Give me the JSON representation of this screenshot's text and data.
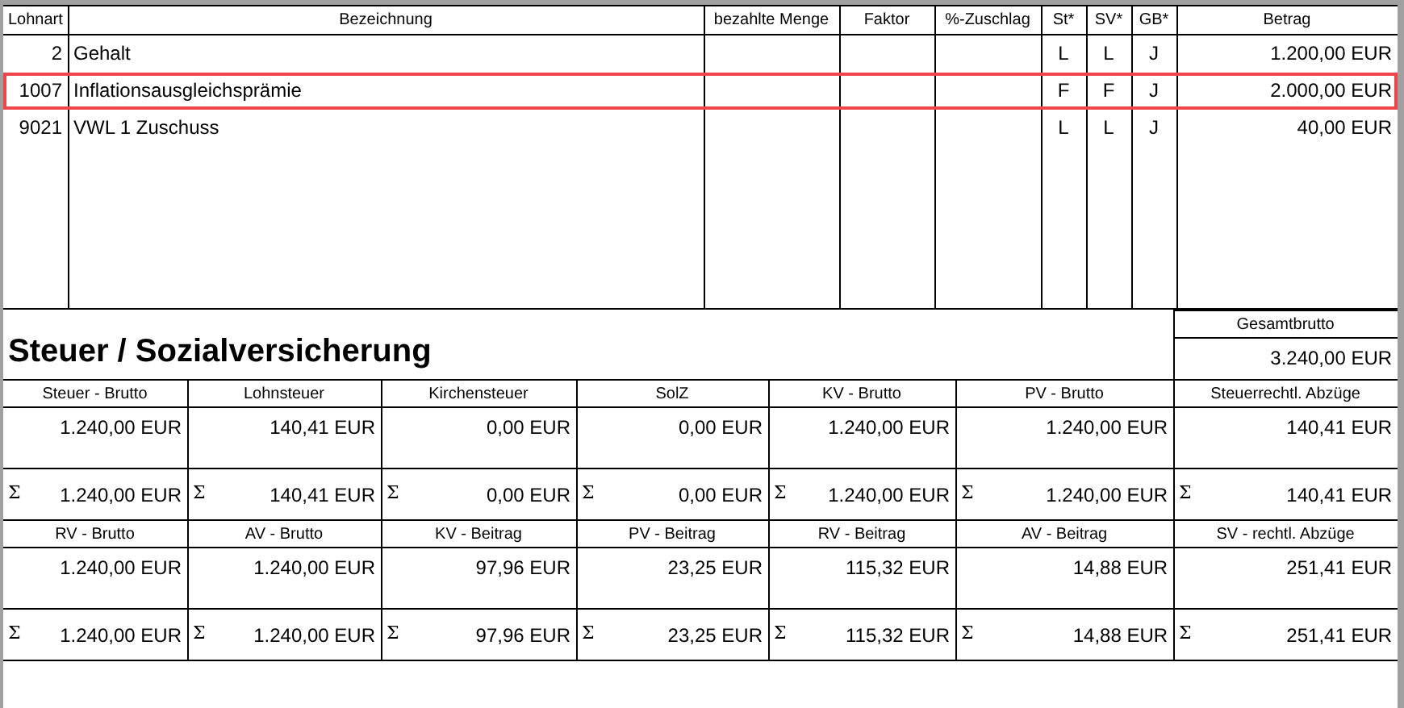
{
  "table": {
    "columns": [
      "Lohnart",
      "Bezeichnung",
      "bezahlte Menge",
      "Faktor",
      "%-Zuschlag",
      "St*",
      "SV*",
      "GB*",
      "Betrag"
    ],
    "rows": [
      {
        "lohnart": "2",
        "bezeichnung": "Gehalt",
        "st": "L",
        "sv": "L",
        "gb": "J",
        "betrag": "1.200,00 EUR",
        "selected": false
      },
      {
        "lohnart": "1007",
        "bezeichnung": "Inflationsausgleichsprämie",
        "st": "F",
        "sv": "F",
        "gb": "J",
        "betrag": "2.000,00 EUR",
        "selected": true
      },
      {
        "lohnart": "9021",
        "bezeichnung": "VWL 1 Zuschuss",
        "st": "L",
        "sv": "L",
        "gb": "J",
        "betrag": "40,00 EUR",
        "selected": false
      }
    ]
  },
  "section": {
    "title": "Steuer / Sozialversicherung",
    "total": {
      "label": "Gesamtbrutto",
      "value": "3.240,00 EUR"
    },
    "blocks": [
      [
        {
          "label": "Steuer - Brutto",
          "value": "1.240,00 EUR",
          "sum_sign": "Σ",
          "sum": "1.240,00 EUR"
        },
        {
          "label": "Lohnsteuer",
          "value": "140,41 EUR",
          "sum_sign": "Σ",
          "sum": "140,41 EUR"
        },
        {
          "label": "Kirchensteuer",
          "value": "0,00 EUR",
          "sum_sign": "Σ",
          "sum": "0,00 EUR"
        },
        {
          "label": "SolZ",
          "value": "0,00 EUR",
          "sum_sign": "Σ",
          "sum": "0,00 EUR"
        },
        {
          "label": "KV - Brutto",
          "value": "1.240,00 EUR",
          "sum_sign": "Σ",
          "sum": "1.240,00 EUR"
        },
        {
          "label": "PV - Brutto",
          "value": "1.240,00 EUR",
          "sum_sign": "Σ",
          "sum": "1.240,00 EUR"
        },
        {
          "label": "Steuerrechtl. Abzüge",
          "value": "140,41 EUR",
          "sum_sign": "Σ",
          "sum": "140,41 EUR"
        }
      ],
      [
        {
          "label": "RV - Brutto",
          "value": "1.240,00 EUR",
          "sum_sign": "Σ",
          "sum": "1.240,00 EUR"
        },
        {
          "label": "AV - Brutto",
          "value": "1.240,00 EUR",
          "sum_sign": "Σ",
          "sum": "1.240,00 EUR"
        },
        {
          "label": "KV - Beitrag",
          "value": "97,96 EUR",
          "sum_sign": "Σ",
          "sum": "97,96 EUR"
        },
        {
          "label": "PV - Beitrag",
          "value": "23,25 EUR",
          "sum_sign": "Σ",
          "sum": "23,25 EUR"
        },
        {
          "label": "RV - Beitrag",
          "value": "115,32 EUR",
          "sum_sign": "Σ",
          "sum": "115,32 EUR"
        },
        {
          "label": "AV - Beitrag",
          "value": "14,88 EUR",
          "sum_sign": "Σ",
          "sum": "14,88 EUR"
        },
        {
          "label": "SV - rechtl. Abzüge",
          "value": "251,41 EUR",
          "sum_sign": "Σ",
          "sum": "251,41 EUR"
        }
      ]
    ]
  }
}
